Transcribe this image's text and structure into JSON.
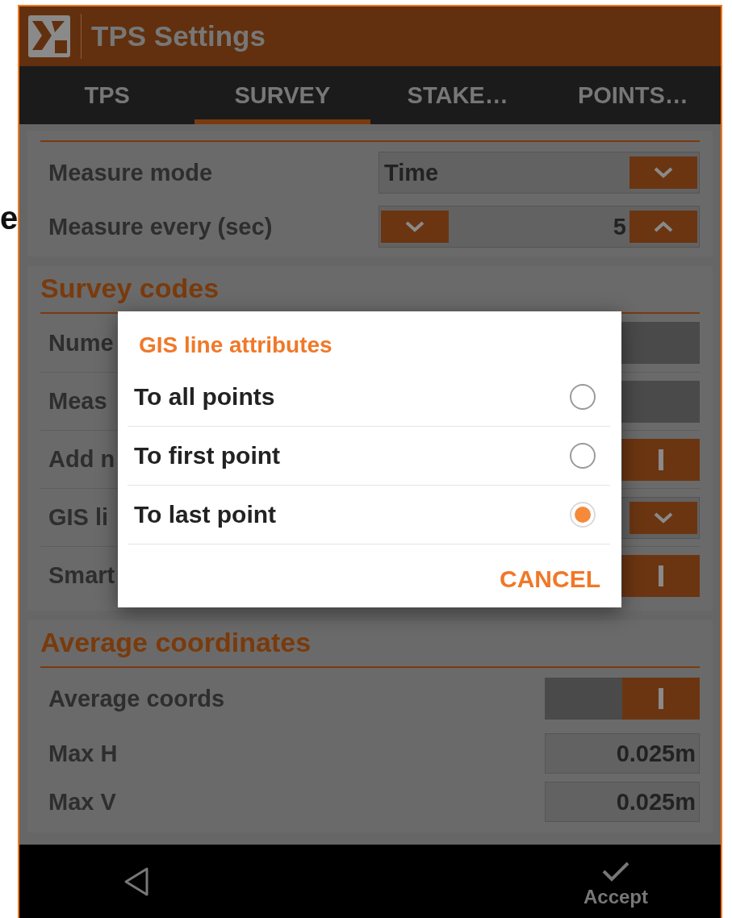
{
  "fragments": [
    {
      "text": "e"
    }
  ],
  "app": {
    "title": "TPS Settings"
  },
  "tabs": [
    {
      "label": "TPS",
      "selected": false
    },
    {
      "label": "SURVEY",
      "selected": true
    },
    {
      "label": "STAKE…",
      "selected": false
    },
    {
      "label": "POINTS…",
      "selected": false
    }
  ],
  "sections": [
    {
      "rows": [
        {
          "label": "Measure mode",
          "kind": "dropdown",
          "value": "Time"
        },
        {
          "label": "Measure every (sec)",
          "kind": "stepper",
          "value": "5"
        }
      ]
    },
    {
      "title": "Survey codes",
      "rows": [
        {
          "label": "Nume",
          "kind": "field"
        },
        {
          "label": "Meas",
          "kind": "field"
        },
        {
          "label": "Add n",
          "kind": "toggle",
          "on": true
        },
        {
          "label": "GIS li",
          "kind": "dropdown"
        },
        {
          "label": "Smart",
          "kind": "toggle",
          "on": true
        }
      ]
    },
    {
      "title": "Average coordinates",
      "rows": [
        {
          "label": "Average coords",
          "kind": "toggle",
          "on": true
        },
        {
          "label": "Max H",
          "kind": "value",
          "value": "0.025m"
        },
        {
          "label": "Max V",
          "kind": "value",
          "value": "0.025m"
        }
      ]
    }
  ],
  "dialog": {
    "title": "GIS line attributes",
    "options": [
      {
        "label": "To all points",
        "selected": false
      },
      {
        "label": "To first point",
        "selected": false
      },
      {
        "label": "To last point",
        "selected": true
      }
    ],
    "cancel": "CANCEL"
  },
  "nav": {
    "accept": "Accept"
  }
}
